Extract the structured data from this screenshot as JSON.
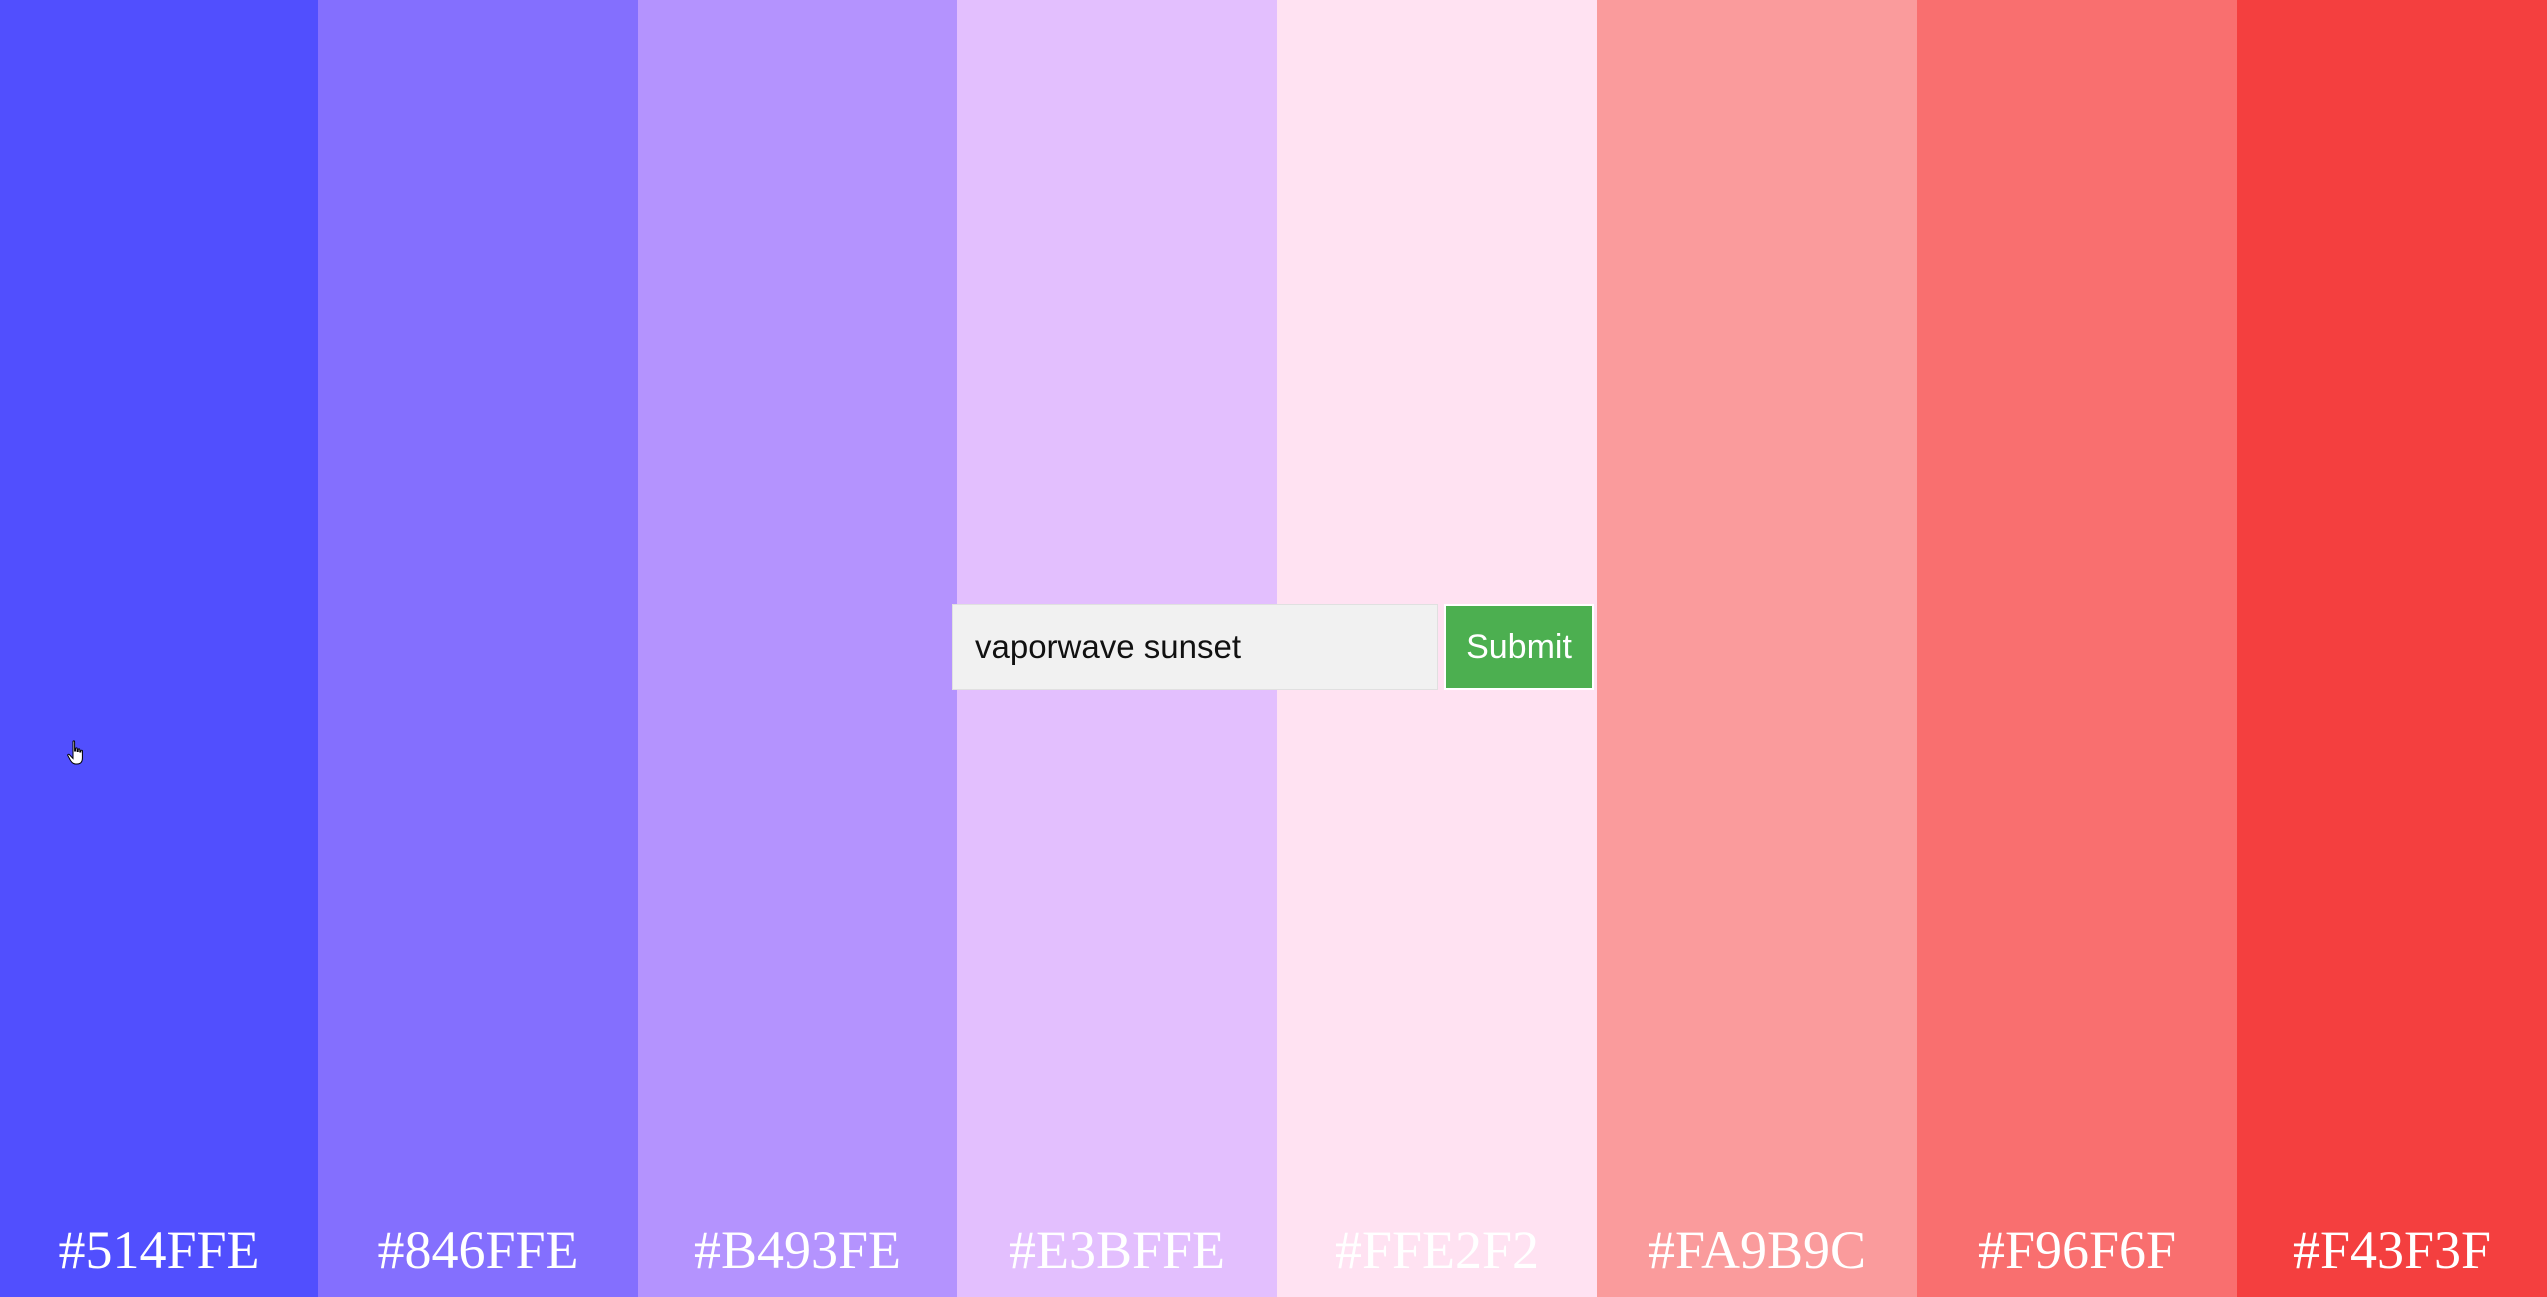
{
  "palette": {
    "swatches": [
      {
        "color": "#514FFE",
        "label": "#514FFE"
      },
      {
        "color": "#846FFE",
        "label": "#846FFE"
      },
      {
        "color": "#B493FE",
        "label": "#B493FE"
      },
      {
        "color": "#E3BFFE",
        "label": "#E3BFFE"
      },
      {
        "color": "#FFE2F2",
        "label": "#FFE2F2"
      },
      {
        "color": "#FA9B9C",
        "label": "#FA9B9C"
      },
      {
        "color": "#F96F6F",
        "label": "#F96F6F"
      },
      {
        "color": "#F43F3F",
        "label": "#F43F3F"
      }
    ]
  },
  "search": {
    "value": "vaporwave sunset",
    "submit_label": "Submit",
    "submit_color": "#4caf50"
  },
  "cursor": {
    "icon": "hand-pointer-icon"
  }
}
